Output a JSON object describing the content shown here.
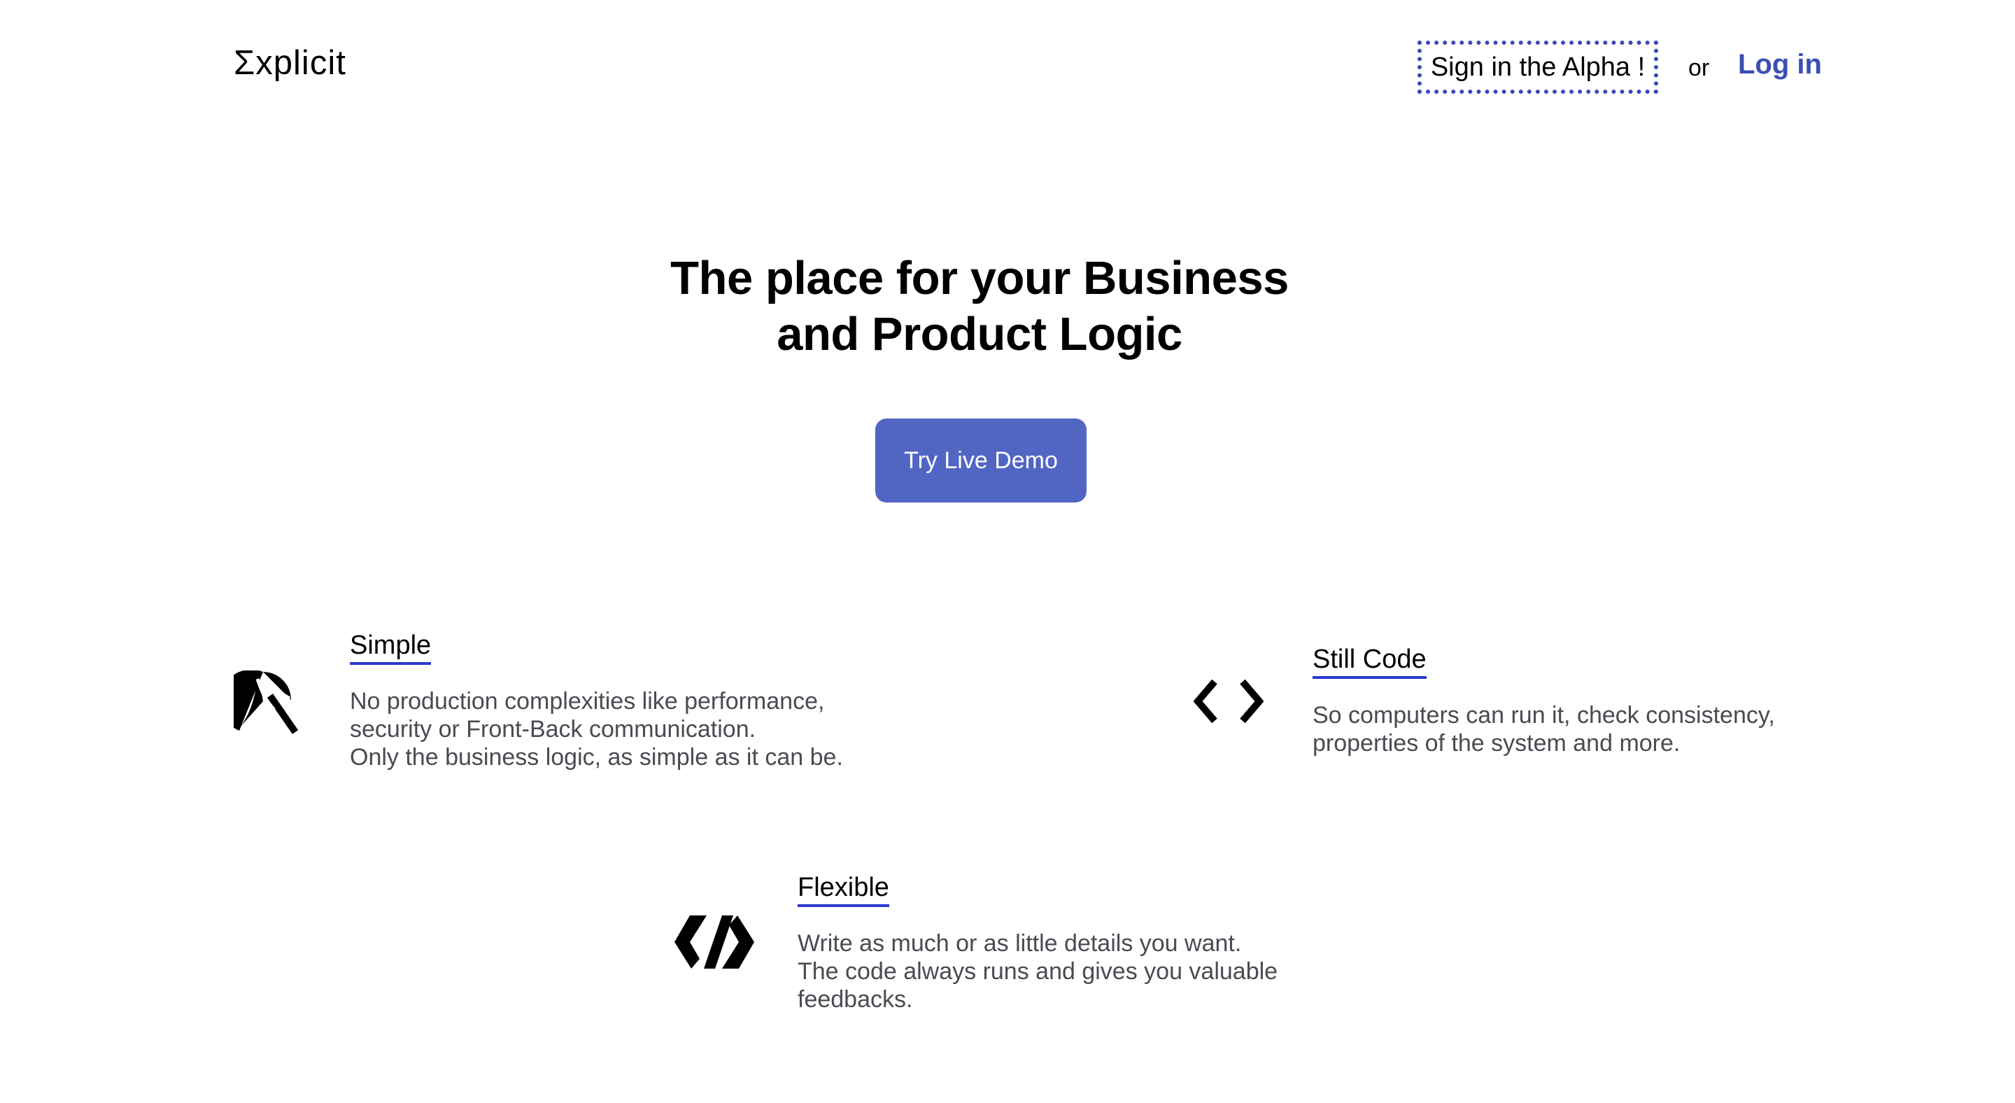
{
  "header": {
    "logo": "Σxplicit",
    "signin_label": "Sign in the Alpha !",
    "or_text": "or",
    "login_label": "Log in"
  },
  "hero": {
    "title_line1": "The place for your Business",
    "title_line2": "and Product Logic",
    "cta_label": "Try Live Demo"
  },
  "features": {
    "simple": {
      "icon": "beach-umbrella-icon",
      "title": "Simple",
      "lines": [
        "No production complexities like performance,",
        "security or Front-Back communication.",
        "Only the business logic, as simple as it can be."
      ]
    },
    "still_code": {
      "icon": "code-brackets-icon",
      "title": "Still Code",
      "lines": [
        "So computers can run it, check consistency,",
        "properties of the system and more."
      ]
    },
    "flexible": {
      "icon": "polymer-icon",
      "title": "Flexible",
      "lines": [
        "Write as much or as little details you want.",
        "The code always runs and gives you valuable",
        "feedbacks."
      ]
    }
  },
  "colors": {
    "accent": "#5166c3",
    "link": "#3a4fb2",
    "underline": "#2c3ad0",
    "body_text": "#4a4a52"
  }
}
